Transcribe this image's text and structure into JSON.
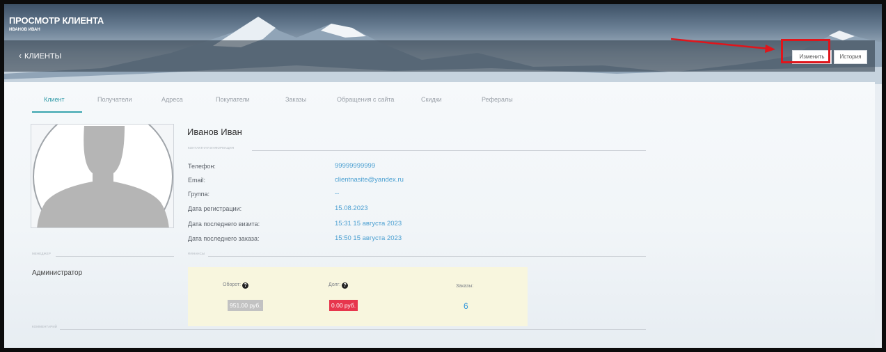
{
  "header": {
    "title": "ПРОСМОТР КЛИЕНТА",
    "subtitle": "ИВАНОВ ИВАН"
  },
  "nav": {
    "back_label": "КЛИЕНТЫ",
    "edit_label": "Изменить",
    "history_label": "История"
  },
  "tabs": [
    "Клиент",
    "Получатели",
    "Адреса",
    "Покупатели",
    "Заказы",
    "Обращения с сайта",
    "Скидки",
    "Рефералы"
  ],
  "active_tab": "Клиент",
  "client": {
    "name": "Иванов Иван",
    "contact_section_label": "КОНТАКТНАЯ ИНФОРМАЦИЯ",
    "fields": [
      {
        "label": "Телефон:",
        "value": "99999999999"
      },
      {
        "label": "Email:",
        "value": "clientnasite@yandex.ru"
      },
      {
        "label": "Группа:",
        "value": "--"
      },
      {
        "label": "Дата регистрации:",
        "value": "15.08.2023"
      },
      {
        "label": "Дата последнего визита:",
        "value": "15:31 15 августа 2023"
      },
      {
        "label": "Дата последнего заказа:",
        "value": "15:50 15 августа 2023"
      }
    ]
  },
  "manager": {
    "section_label": "МЕНЕДЖЕР",
    "name": "Администратор"
  },
  "finance": {
    "section_label": "ФИНАНСЫ",
    "turnover_label": "Оборот:",
    "turnover_value": "951.00 руб.",
    "debt_label": "Долг:",
    "debt_value": "0.00 руб.",
    "orders_label": "Заказы:",
    "orders_value": "6"
  },
  "comment": {
    "section_label": "КОММЕНТАРИЙ"
  },
  "colors": {
    "accent": "#37a3ad",
    "link": "#4a9fd1",
    "debt_badge": "#e7364d",
    "turnover_badge": "#c2c2c2",
    "finance_bg": "#f8f6de",
    "highlight": "#e0151b"
  },
  "icons": {
    "back": "chevron-left-icon",
    "help": "question-circle-icon",
    "avatar": "user-silhouette-icon",
    "annotation": "red-arrow-annotation"
  }
}
